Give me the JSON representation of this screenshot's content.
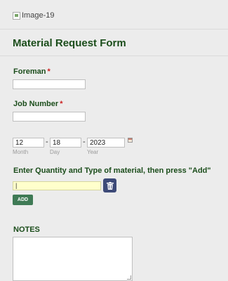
{
  "header": {
    "image_alt": "Image-19"
  },
  "form": {
    "title": "Material Request Form",
    "foreman": {
      "label": "Foreman",
      "required_mark": "*",
      "value": ""
    },
    "job_number": {
      "label": "Job Number",
      "required_mark": "*",
      "value": ""
    },
    "date": {
      "month": {
        "value": "12",
        "sublabel": "Month"
      },
      "day": {
        "value": "18",
        "sublabel": "Day"
      },
      "year": {
        "value": "2023",
        "sublabel": "Year"
      },
      "separator": "-"
    },
    "material": {
      "label": "Enter Quantity and Type of material, then press \"Add\"",
      "value": "",
      "add_label": "ADD",
      "delete_icon": "trash-icon"
    },
    "notes": {
      "label": "NOTES",
      "value": ""
    }
  },
  "colors": {
    "heading": "#1b4d1b",
    "required": "#cc2222",
    "add_button": "#3f7a55",
    "delete_button": "#3d4a78",
    "highlight_input": "#ffffcc"
  }
}
